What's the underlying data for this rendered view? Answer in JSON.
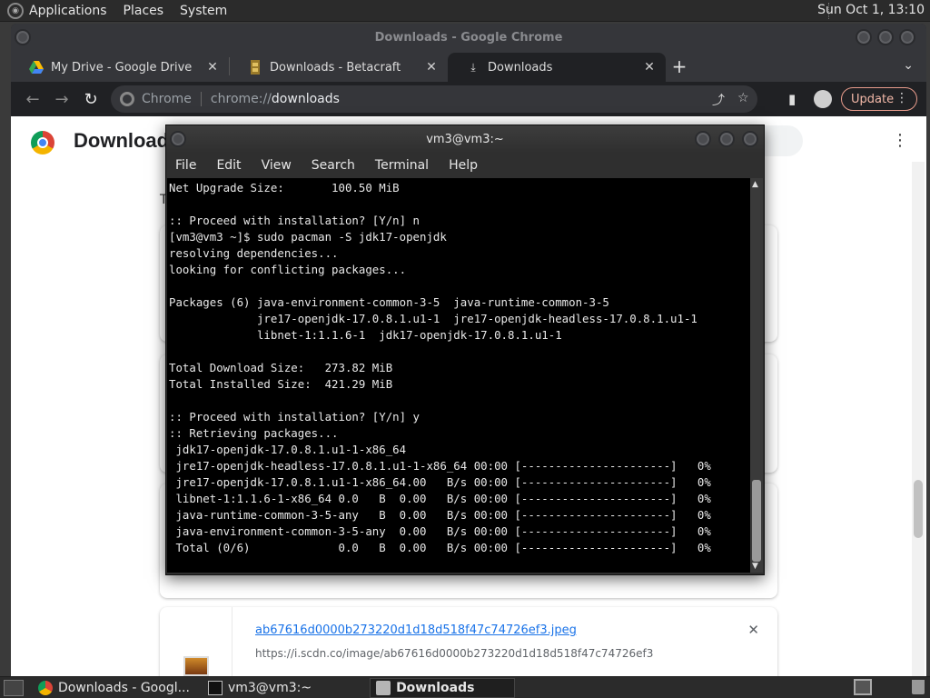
{
  "top_panel": {
    "menus": [
      "Applications",
      "Places",
      "System"
    ],
    "clock": "Sun Oct  1, 13:10"
  },
  "chrome": {
    "window_title": "Downloads - Google Chrome",
    "tabs": [
      {
        "label": "My Drive - Google Drive",
        "icon": "google-drive-icon",
        "active": false
      },
      {
        "label": "Downloads - Betacraft",
        "icon": "betacraft-icon",
        "active": false
      },
      {
        "label": "Downloads",
        "icon": "download-icon",
        "active": true
      }
    ],
    "omnibox": {
      "site": "Chrome",
      "scheme": "chrome://",
      "host": "downloads"
    },
    "update_label": "Update"
  },
  "downloads_page": {
    "title": "Downloads",
    "partial_letter": "T",
    "item": {
      "filename": "ab67616d0000b273220d1d18d518f47c74726ef3.jpeg",
      "url": "https://i.scdn.co/image/ab67616d0000b273220d1d18d518f47c74726ef3"
    }
  },
  "terminal": {
    "title": "vm3@vm3:~",
    "menu": [
      "File",
      "Edit",
      "View",
      "Search",
      "Terminal",
      "Help"
    ],
    "lines": [
      "Net Upgrade Size:       100.50 MiB",
      "",
      ":: Proceed with installation? [Y/n] n",
      "[vm3@vm3 ~]$ sudo pacman -S jdk17-openjdk",
      "resolving dependencies...",
      "looking for conflicting packages...",
      "",
      "Packages (6) java-environment-common-3-5  java-runtime-common-3-5",
      "             jre17-openjdk-17.0.8.1.u1-1  jre17-openjdk-headless-17.0.8.1.u1-1",
      "             libnet-1:1.1.6-1  jdk17-openjdk-17.0.8.1.u1-1",
      "",
      "Total Download Size:   273.82 MiB",
      "Total Installed Size:  421.29 MiB",
      "",
      ":: Proceed with installation? [Y/n] y",
      ":: Retrieving packages...",
      " jdk17-openjdk-17.0.8.1.u1-1-x86_64",
      " jre17-openjdk-headless-17.0.8.1.u1-1-x86_64 00:00 [----------------------]   0%",
      " jre17-openjdk-17.0.8.1.u1-1-x86_64.00   B/s 00:00 [----------------------]   0%",
      " libnet-1:1.1.6-1-x86_64 0.0   B  0.00   B/s 00:00 [----------------------]   0%",
      " java-runtime-common-3-5-any   B  0.00   B/s 00:00 [----------------------]   0%",
      " java-environment-common-3-5-any  0.00   B/s 00:00 [----------------------]   0%",
      " Total (0/6)             0.0   B  0.00   B/s 00:00 [----------------------]   0%"
    ]
  },
  "taskbar": {
    "items": [
      {
        "label": "Downloads - Googl...",
        "icon": "chrome-icon",
        "active": false
      },
      {
        "label": "vm3@vm3:~",
        "icon": "terminal-icon",
        "active": false
      },
      {
        "label": "Downloads",
        "icon": "folder-icon",
        "active": true
      }
    ]
  }
}
